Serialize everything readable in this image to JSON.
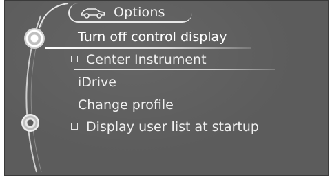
{
  "header": {
    "title": "Options",
    "icon": "car-icon"
  },
  "menu": {
    "items": [
      {
        "label": "Turn off control display",
        "checkbox": false,
        "selected": true
      },
      {
        "label": "Center Instrument",
        "checkbox": true,
        "selected": false
      },
      {
        "label": "iDrive",
        "checkbox": false,
        "selected": false
      },
      {
        "label": "Change profile",
        "checkbox": false,
        "selected": false
      },
      {
        "label": "Display user list at startup",
        "checkbox": true,
        "selected": false
      }
    ]
  },
  "colors": {
    "background": "#5c5c5c",
    "text": "#f0f0f0",
    "accent": "#ffffff"
  }
}
